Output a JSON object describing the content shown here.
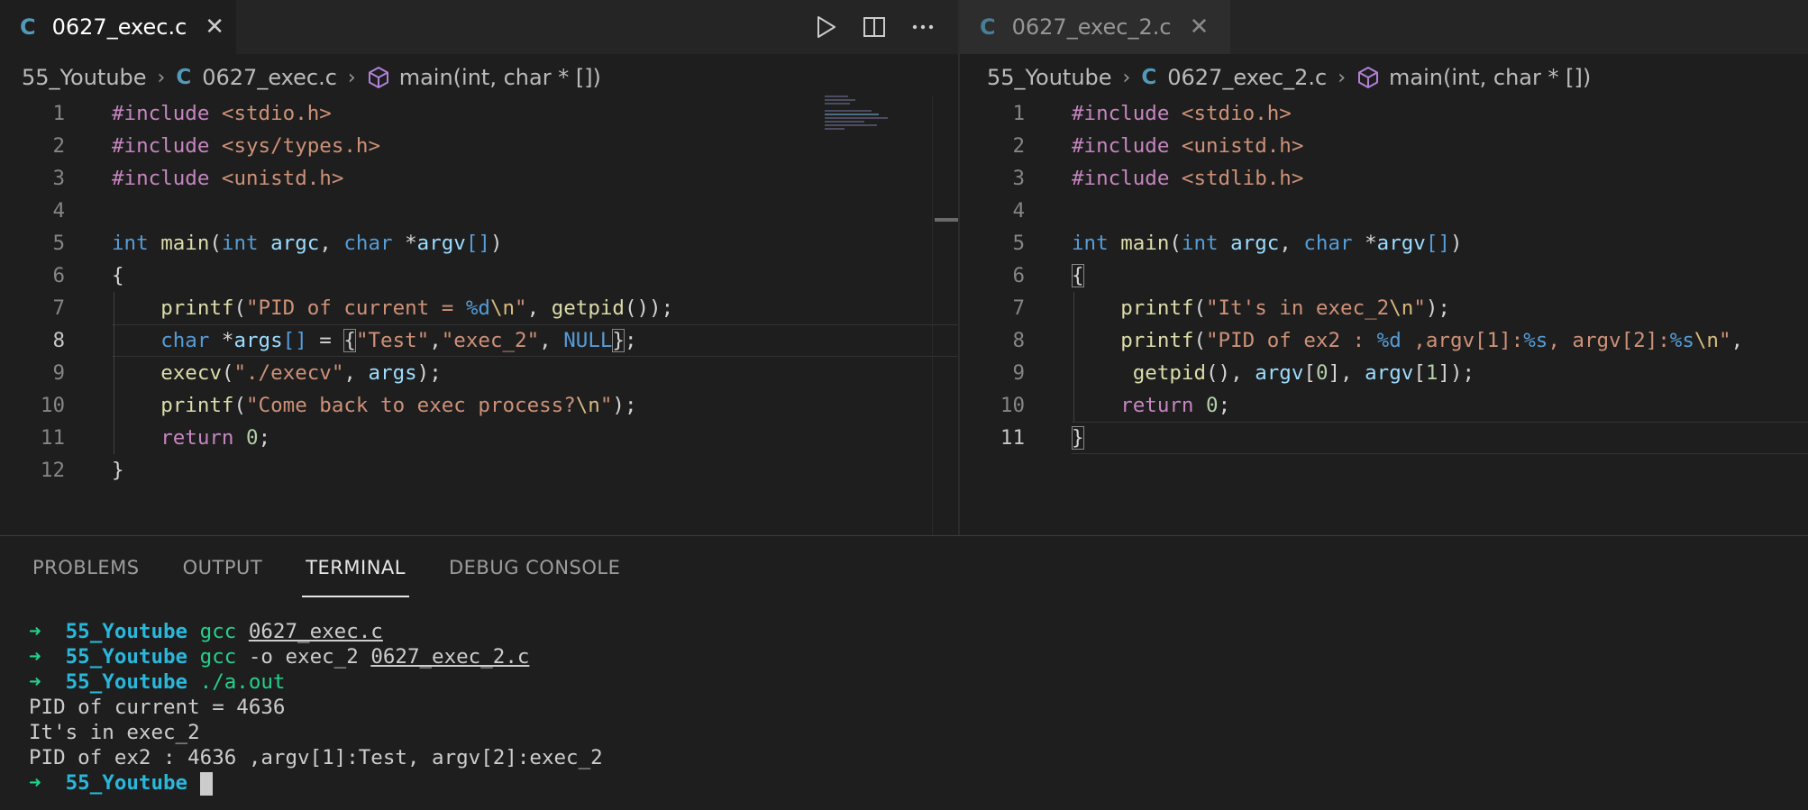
{
  "left_editor": {
    "tab": {
      "icon": "C",
      "title": "0627_exec.c",
      "close": "✕"
    },
    "breadcrumb": {
      "folder": "55_Youtube",
      "file": "0627_exec.c",
      "symbol": "main(int, char * [])"
    },
    "actions": [
      "run-icon",
      "split-editor-icon",
      "more-actions-icon"
    ],
    "current_line": 8,
    "lines": [
      {
        "n": "1",
        "tokens": [
          {
            "t": "#include",
            "c": "pp"
          },
          {
            "t": " <stdio.h>",
            "c": "inc"
          }
        ]
      },
      {
        "n": "2",
        "tokens": [
          {
            "t": "#include",
            "c": "pp"
          },
          {
            "t": " <sys/types.h>",
            "c": "inc"
          }
        ]
      },
      {
        "n": "3",
        "tokens": [
          {
            "t": "#include",
            "c": "pp"
          },
          {
            "t": " <unistd.h>",
            "c": "inc"
          }
        ]
      },
      {
        "n": "4",
        "tokens": []
      },
      {
        "n": "5",
        "tokens": [
          {
            "t": "int",
            "c": "kw"
          },
          {
            "t": " ",
            "c": "br"
          },
          {
            "t": "main",
            "c": "fn"
          },
          {
            "t": "(",
            "c": "br"
          },
          {
            "t": "int",
            "c": "kw"
          },
          {
            "t": " ",
            "c": "br"
          },
          {
            "t": "argc",
            "c": "var"
          },
          {
            "t": ", ",
            "c": "br"
          },
          {
            "t": "char",
            "c": "kw"
          },
          {
            "t": " *",
            "c": "br"
          },
          {
            "t": "argv",
            "c": "var"
          },
          {
            "t": "[]",
            "c": "kw"
          },
          {
            "t": ")",
            "c": "br"
          }
        ]
      },
      {
        "n": "6",
        "tokens": [
          {
            "t": "{",
            "c": "br"
          }
        ]
      },
      {
        "n": "7",
        "tokens": [
          {
            "t": "    ",
            "c": "br"
          },
          {
            "t": "printf",
            "c": "fn"
          },
          {
            "t": "(",
            "c": "br"
          },
          {
            "t": "\"PID of current = ",
            "c": "str"
          },
          {
            "t": "%d",
            "c": "kw"
          },
          {
            "t": "\\n",
            "c": "sb"
          },
          {
            "t": "\"",
            "c": "str"
          },
          {
            "t": ", ",
            "c": "br"
          },
          {
            "t": "getpid",
            "c": "fn"
          },
          {
            "t": "());",
            "c": "br"
          }
        ]
      },
      {
        "n": "8",
        "tokens": [
          {
            "t": "    ",
            "c": "br"
          },
          {
            "t": "char",
            "c": "kw"
          },
          {
            "t": " *",
            "c": "br"
          },
          {
            "t": "args",
            "c": "var"
          },
          {
            "t": "[]",
            "c": "kw"
          },
          {
            "t": " = ",
            "c": "br"
          },
          {
            "t": "{",
            "c": "br bm"
          },
          {
            "t": "\"Test\"",
            "c": "str"
          },
          {
            "t": ",",
            "c": "br"
          },
          {
            "t": "\"exec_2\"",
            "c": "str"
          },
          {
            "t": ", ",
            "c": "br"
          },
          {
            "t": "NULL",
            "c": "kw"
          },
          {
            "t": "}",
            "c": "br bm"
          },
          {
            "t": ";",
            "c": "br"
          }
        ]
      },
      {
        "n": "9",
        "tokens": [
          {
            "t": "    ",
            "c": "br"
          },
          {
            "t": "execv",
            "c": "fn"
          },
          {
            "t": "(",
            "c": "br"
          },
          {
            "t": "\"./execv\"",
            "c": "str"
          },
          {
            "t": ", ",
            "c": "br"
          },
          {
            "t": "args",
            "c": "var"
          },
          {
            "t": ");",
            "c": "br"
          }
        ]
      },
      {
        "n": "10",
        "tokens": [
          {
            "t": "    ",
            "c": "br"
          },
          {
            "t": "printf",
            "c": "fn"
          },
          {
            "t": "(",
            "c": "br"
          },
          {
            "t": "\"Come back to exec process?",
            "c": "str"
          },
          {
            "t": "\\n",
            "c": "sb"
          },
          {
            "t": "\"",
            "c": "str"
          },
          {
            "t": ");",
            "c": "br"
          }
        ]
      },
      {
        "n": "11",
        "tokens": [
          {
            "t": "    ",
            "c": "br"
          },
          {
            "t": "return",
            "c": "ctl"
          },
          {
            "t": " ",
            "c": "br"
          },
          {
            "t": "0",
            "c": "num"
          },
          {
            "t": ";",
            "c": "br"
          }
        ]
      },
      {
        "n": "12",
        "tokens": [
          {
            "t": "}",
            "c": "br"
          }
        ]
      }
    ]
  },
  "right_editor": {
    "tab": {
      "icon": "C",
      "title": "0627_exec_2.c",
      "close": "✕"
    },
    "breadcrumb": {
      "folder": "55_Youtube",
      "file": "0627_exec_2.c",
      "symbol": "main(int, char * [])"
    },
    "current_line": 11,
    "lines": [
      {
        "n": "1",
        "tokens": [
          {
            "t": "#include",
            "c": "pp"
          },
          {
            "t": " <stdio.h>",
            "c": "inc"
          }
        ]
      },
      {
        "n": "2",
        "tokens": [
          {
            "t": "#include",
            "c": "pp"
          },
          {
            "t": " <unistd.h>",
            "c": "inc"
          }
        ]
      },
      {
        "n": "3",
        "tokens": [
          {
            "t": "#include",
            "c": "pp"
          },
          {
            "t": " <stdlib.h>",
            "c": "inc"
          }
        ]
      },
      {
        "n": "4",
        "tokens": []
      },
      {
        "n": "5",
        "tokens": [
          {
            "t": "int",
            "c": "kw"
          },
          {
            "t": " ",
            "c": "br"
          },
          {
            "t": "main",
            "c": "fn"
          },
          {
            "t": "(",
            "c": "br"
          },
          {
            "t": "int",
            "c": "kw"
          },
          {
            "t": " ",
            "c": "br"
          },
          {
            "t": "argc",
            "c": "var"
          },
          {
            "t": ", ",
            "c": "br"
          },
          {
            "t": "char",
            "c": "kw"
          },
          {
            "t": " *",
            "c": "br"
          },
          {
            "t": "argv",
            "c": "var"
          },
          {
            "t": "[]",
            "c": "kw"
          },
          {
            "t": ")",
            "c": "br"
          }
        ]
      },
      {
        "n": "6",
        "tokens": [
          {
            "t": "{",
            "c": "br bm"
          }
        ]
      },
      {
        "n": "7",
        "tokens": [
          {
            "t": "    ",
            "c": "br"
          },
          {
            "t": "printf",
            "c": "fn"
          },
          {
            "t": "(",
            "c": "br"
          },
          {
            "t": "\"It's in exec_2",
            "c": "str"
          },
          {
            "t": "\\n",
            "c": "sb"
          },
          {
            "t": "\"",
            "c": "str"
          },
          {
            "t": ");",
            "c": "br"
          }
        ]
      },
      {
        "n": "8",
        "tokens": [
          {
            "t": "    ",
            "c": "br"
          },
          {
            "t": "printf",
            "c": "fn"
          },
          {
            "t": "(",
            "c": "br"
          },
          {
            "t": "\"PID of ex2 : ",
            "c": "str"
          },
          {
            "t": "%d",
            "c": "kw"
          },
          {
            "t": " ,argv[1]:",
            "c": "str"
          },
          {
            "t": "%s",
            "c": "kw"
          },
          {
            "t": ", argv[2]:",
            "c": "str"
          },
          {
            "t": "%s",
            "c": "kw"
          },
          {
            "t": "\\n",
            "c": "sb"
          },
          {
            "t": "\"",
            "c": "str"
          },
          {
            "t": ",",
            "c": "br"
          }
        ]
      },
      {
        "n": "9",
        "tokens": [
          {
            "t": "     ",
            "c": "br"
          },
          {
            "t": "getpid",
            "c": "fn"
          },
          {
            "t": "(), ",
            "c": "br"
          },
          {
            "t": "argv",
            "c": "var"
          },
          {
            "t": "[",
            "c": "br"
          },
          {
            "t": "0",
            "c": "num"
          },
          {
            "t": "], ",
            "c": "br"
          },
          {
            "t": "argv",
            "c": "var"
          },
          {
            "t": "[",
            "c": "br"
          },
          {
            "t": "1",
            "c": "num"
          },
          {
            "t": "]);",
            "c": "br"
          }
        ]
      },
      {
        "n": "10",
        "tokens": [
          {
            "t": "    ",
            "c": "br"
          },
          {
            "t": "return",
            "c": "ctl"
          },
          {
            "t": " ",
            "c": "br"
          },
          {
            "t": "0",
            "c": "num"
          },
          {
            "t": ";",
            "c": "br"
          }
        ]
      },
      {
        "n": "11",
        "tokens": [
          {
            "t": "}",
            "c": "br bm"
          }
        ]
      }
    ]
  },
  "panel": {
    "tabs": [
      "PROBLEMS",
      "OUTPUT",
      "TERMINAL",
      "DEBUG CONSOLE"
    ],
    "active_tab": "TERMINAL",
    "terminal": [
      {
        "prompt": true,
        "dir": "55_Youtube",
        "cmd": "gcc",
        "args": [
          {
            "t": " ",
            "u": false
          },
          {
            "t": "0627_exec.c",
            "u": true
          }
        ]
      },
      {
        "prompt": true,
        "dir": "55_Youtube",
        "cmd": "gcc",
        "args": [
          {
            "t": " -o exec_2 ",
            "u": false
          },
          {
            "t": "0627_exec_2.c",
            "u": true
          }
        ]
      },
      {
        "prompt": true,
        "dir": "55_Youtube",
        "cmd": "./a.out",
        "args": []
      },
      {
        "prompt": false,
        "text": "PID of current = 4636"
      },
      {
        "prompt": false,
        "text": "It's in exec_2"
      },
      {
        "prompt": false,
        "text": "PID of ex2 : 4636 ,argv[1]:Test, argv[2]:exec_2"
      },
      {
        "prompt": true,
        "dir": "55_Youtube",
        "cmd": "",
        "args": [],
        "cursor": true
      }
    ],
    "prompt_arrow": "➜"
  },
  "colors": {
    "accent_c_icon": "#519aba",
    "terminal_prompt": "#23d18b",
    "terminal_dir": "#29b8db"
  }
}
